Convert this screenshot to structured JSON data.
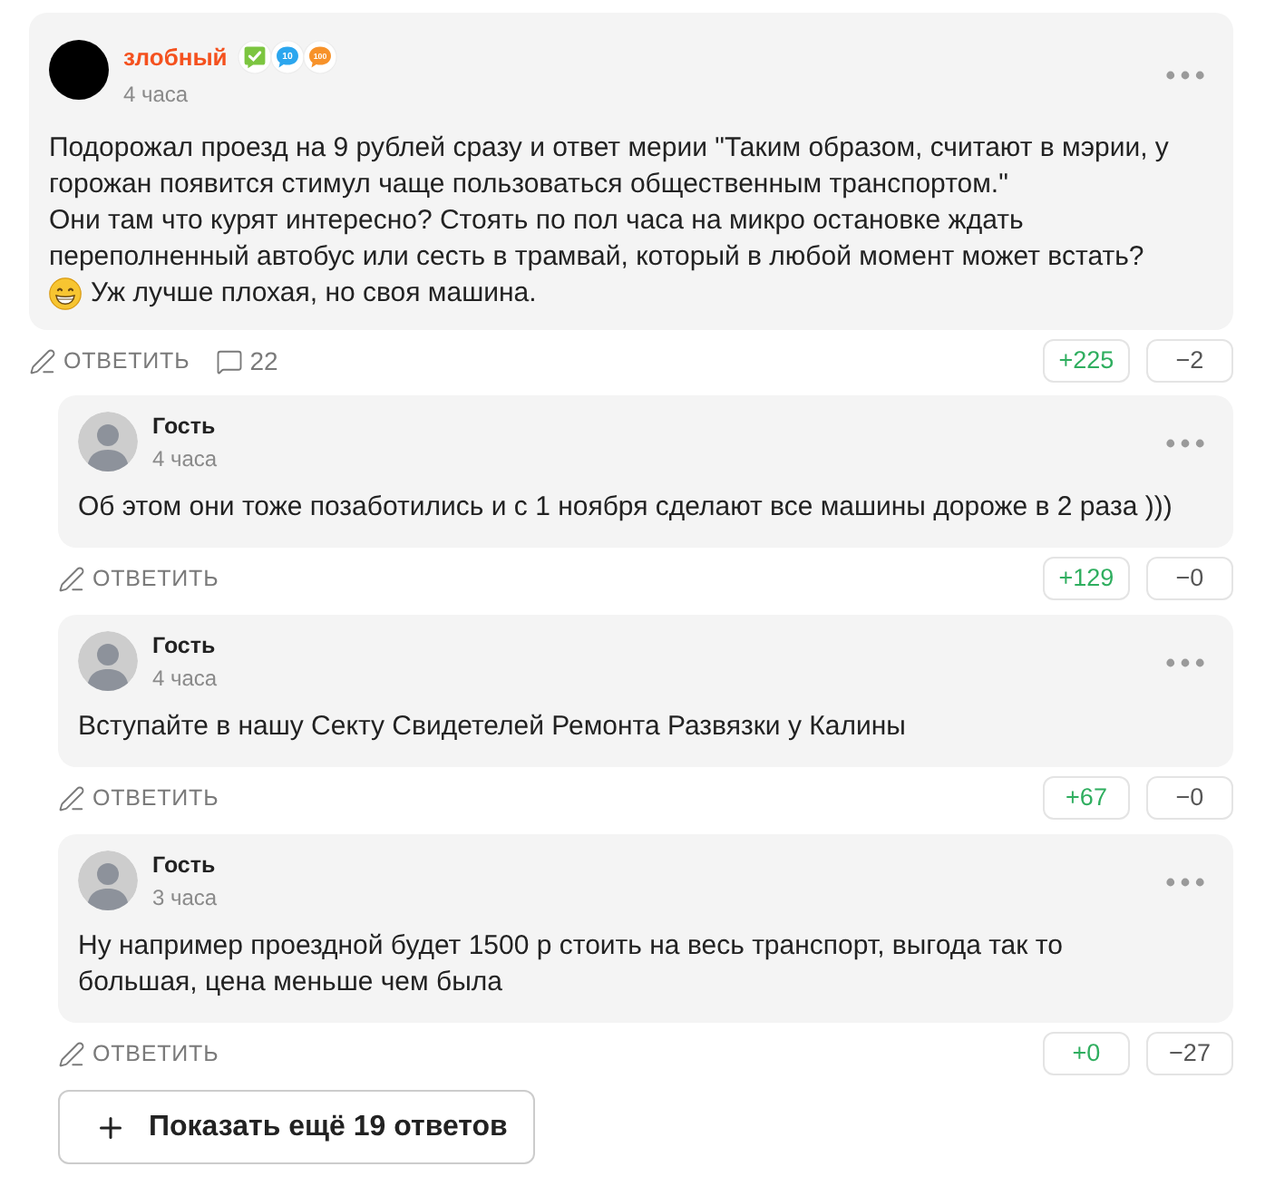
{
  "comment": {
    "kind": "member",
    "author": "злобный",
    "badges": [
      {
        "kind": "check",
        "color": "#7cc540"
      },
      {
        "kind": "bubble",
        "label": "10",
        "color": "#2ba6ee"
      },
      {
        "kind": "bubble",
        "label": "100",
        "color": "#f7922a"
      }
    ],
    "time": "4 часа",
    "paragraphs": [
      {
        "kind": "text",
        "text": "Подорожал проезд на 9 рублей сразу и ответ мерии \"Таким образом, считают в мэрии, у горожан появится стимул чаще пользоваться общественным транспортом.\""
      },
      {
        "kind": "text",
        "text": "Они там что курят интересно? Стоять по пол часа на микро остановке ждать переполненный автобус или сесть в трамвай, который в любой момент может встать?"
      },
      {
        "kind": "emoji",
        "text": "Уж лучше плохая, но своя машина."
      }
    ],
    "reply_label": "ОТВЕТИТЬ",
    "reply_count": "22",
    "votes": {
      "up": "+225",
      "down": "−2"
    }
  },
  "replies": [
    {
      "kind": "guest",
      "author": "Гость",
      "time": "4 часа",
      "paragraphs": [
        {
          "kind": "text",
          "text": "Об этом они тоже позаботились и с 1 ноября сделают все машины дороже в 2 раза )))"
        }
      ],
      "reply_label": "ОТВЕТИТЬ",
      "votes": {
        "up": "+129",
        "down": "−0"
      }
    },
    {
      "kind": "guest",
      "author": "Гость",
      "time": "4 часа",
      "paragraphs": [
        {
          "kind": "text",
          "text": "Вступайте в нашу Секту Свидетелей Ремонта Развязки у Калины"
        }
      ],
      "reply_label": "ОТВЕТИТЬ",
      "votes": {
        "up": "+67",
        "down": "−0"
      }
    },
    {
      "kind": "guest",
      "author": "Гость",
      "time": "3 часа",
      "paragraphs": [
        {
          "kind": "text",
          "text": "Ну например проездной будет 1500 р стоить на весь транспорт, выгода так то большая, цена меньше чем была"
        }
      ],
      "reply_label": "ОТВЕТИТЬ",
      "votes": {
        "up": "+0",
        "down": "−27"
      }
    }
  ],
  "show_more": {
    "label": "Показать ещё 19 ответов"
  }
}
